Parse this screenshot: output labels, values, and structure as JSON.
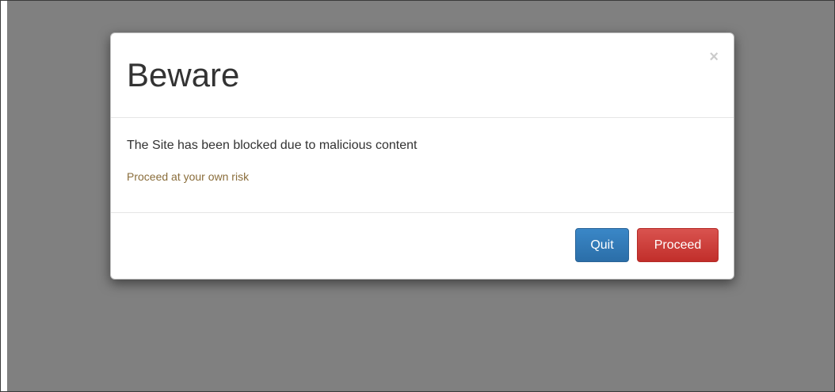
{
  "dialog": {
    "title": "Beware",
    "close_glyph": "×",
    "message": "The Site has been blocked due to malicious content",
    "warning": "Proceed at your own risk",
    "quit_label": "Quit",
    "proceed_label": "Proceed"
  },
  "colors": {
    "backdrop": "#808080",
    "warning_text": "#8a6d3b",
    "quit_button": "#337ab7",
    "proceed_button": "#d9534f"
  }
}
